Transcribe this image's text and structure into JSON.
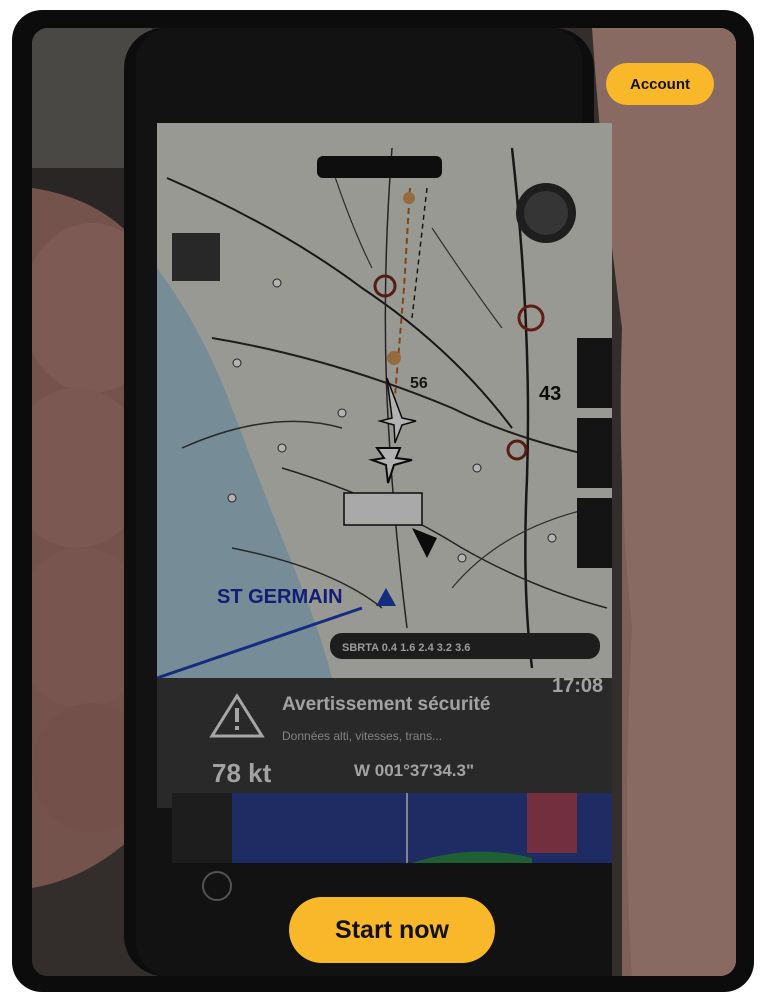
{
  "header": {
    "account_label": "Account"
  },
  "hero": {
    "app_screen": {
      "map_city_label": "ST GERMAIN",
      "map_altitude_label": "43",
      "map_route_number": "56",
      "warning_title": "Avertissement sécurité",
      "warning_body": "Données alti, vitesses, trans...",
      "speed_readout": "78 kt",
      "coordinate_readout": "W 001°37'34.3\"",
      "clock_readout": "17:08"
    }
  },
  "cta": {
    "start_label": "Start now"
  },
  "colors": {
    "accent": "#f9b82a",
    "device_frame": "#0c0c0c",
    "map_water": "#a9c9d8",
    "map_land": "#dcdcd4"
  }
}
